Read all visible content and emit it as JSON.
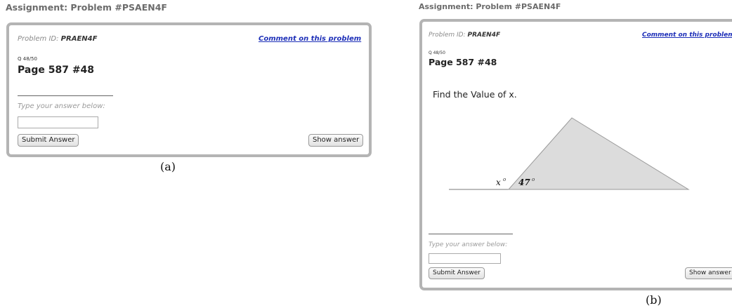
{
  "assignment_title": "Assignment: Problem #PSAEN4F",
  "problem": {
    "id_label": "Problem ID:",
    "id_value": "PRAEN4F",
    "comment_link": "Comment on this problem",
    "question_number": "Q 48/50",
    "page_title": "Page 587 #48",
    "question_text": "Find the Value of x.",
    "answer_label": "Type your answer below:",
    "answer_value": "",
    "submit_label": "Submit Answer",
    "show_answer_label": "Show answer"
  },
  "figure": {
    "angle_x_label": "x",
    "angle_x_degree": "o",
    "angle_known_label": "47",
    "angle_known_degree": "o",
    "known_angle_degrees": 47,
    "triangle_fill": "#dcdcdc",
    "triangle_stroke": "#9a9a9a"
  },
  "captions": {
    "left": "(a)",
    "right": "(b)"
  },
  "colors": {
    "border": "#b4b4b4",
    "link": "#1d2fb8",
    "title_gray": "#6b6b6b"
  }
}
